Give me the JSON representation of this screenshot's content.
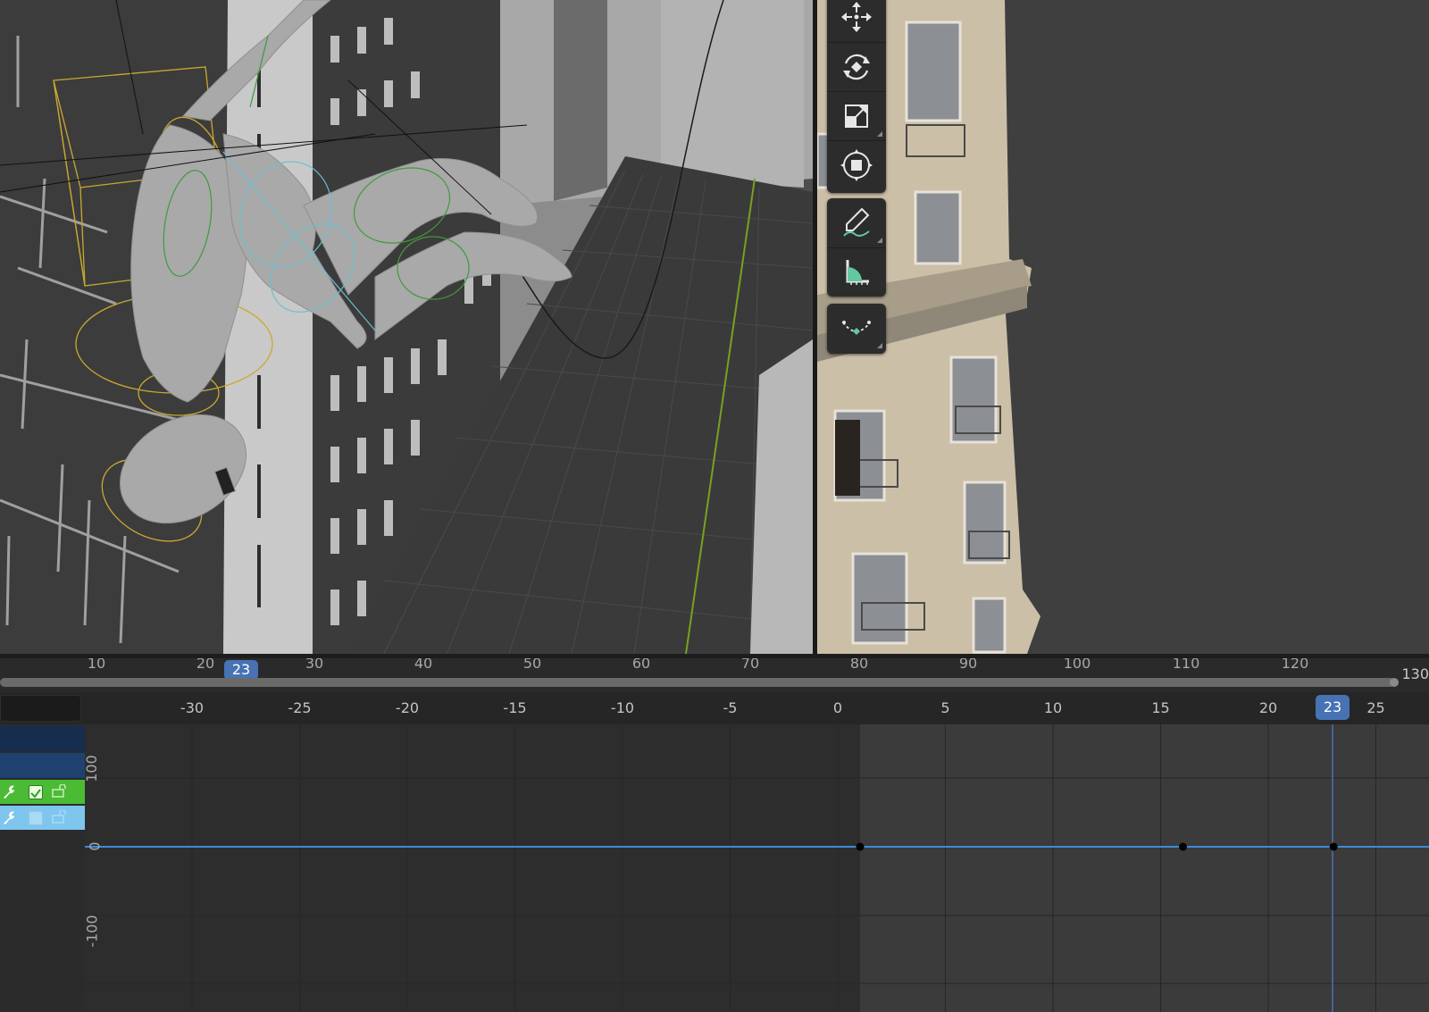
{
  "toolbar": {
    "tools": [
      {
        "name": "move",
        "icon": "move-icon"
      },
      {
        "name": "rotate",
        "icon": "rotate-icon"
      },
      {
        "name": "scale",
        "icon": "scale-icon"
      },
      {
        "name": "transform",
        "icon": "transform-icon"
      },
      {
        "name": "annotate",
        "icon": "annotate-pencil-icon"
      },
      {
        "name": "measure",
        "icon": "measure-ruler-icon"
      },
      {
        "name": "extrude",
        "icon": "curve-handle-icon"
      }
    ]
  },
  "timeline": {
    "frame_labels": [
      "10",
      "20",
      "30",
      "40",
      "50",
      "60",
      "70",
      "80",
      "90",
      "100",
      "110",
      "120"
    ],
    "current_frame": "23",
    "frame_end": "130"
  },
  "graph_editor": {
    "frame_ticks": [
      "-30",
      "-25",
      "-20",
      "-15",
      "-10",
      "-5",
      "0",
      "5",
      "10",
      "15",
      "20",
      "25"
    ],
    "current_frame": "23",
    "value_ticks": [
      "100",
      "0",
      "-100"
    ],
    "channel_colors": {
      "row1": "#162d4f",
      "row2": "#1e4170",
      "row3": "#4bbb36",
      "row4": "#7ec6ee"
    },
    "curve_color": "#3d8bd8",
    "keyframes_frames": [
      0,
      15,
      22
    ]
  },
  "colors": {
    "accent": "#4772b3",
    "background": "#3d3d3d"
  }
}
